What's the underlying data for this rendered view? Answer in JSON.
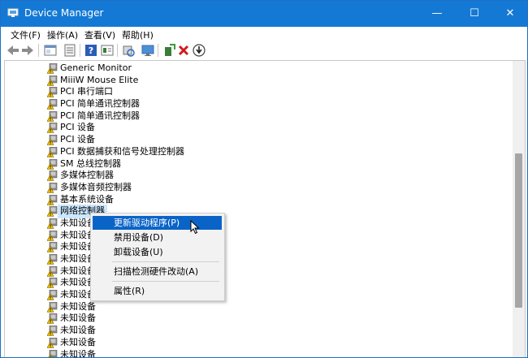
{
  "window": {
    "title": "Device Manager",
    "minimize": "—",
    "maximize": "☐",
    "close": "✕"
  },
  "menu": [
    "文件(F)",
    "操作(A)",
    "查看(V)",
    "帮助(H)"
  ],
  "toolbar_icons": [
    "back-arrow-icon",
    "forward-arrow-icon",
    "properties-sheet-icon",
    "console-tree-icon",
    "help-icon",
    "refresh-panel-icon",
    "scan-hardware-icon",
    "monitor-icon",
    "add-driver-icon",
    "uninstall-x-icon",
    "download-driver-icon"
  ],
  "tree": [
    {
      "label": "Generic Monitor",
      "icon": "monitor-warning"
    },
    {
      "label": "MiiiW Mouse Elite",
      "icon": "device-warning"
    },
    {
      "label": "PCI 串行端口",
      "icon": "device-warning"
    },
    {
      "label": "PCI 简单通讯控制器",
      "icon": "device-warning"
    },
    {
      "label": "PCI 简单通讯控制器",
      "icon": "device-warning"
    },
    {
      "label": "PCI 设备",
      "icon": "device-warning"
    },
    {
      "label": "PCI 设备",
      "icon": "device-warning"
    },
    {
      "label": "PCI 数据捕获和信号处理控制器",
      "icon": "device-warning"
    },
    {
      "label": "SM 总线控制器",
      "icon": "device-warning"
    },
    {
      "label": "多媒体控制器",
      "icon": "device-warning"
    },
    {
      "label": "多媒体音频控制器",
      "icon": "device-warning"
    },
    {
      "label": "基本系统设备",
      "icon": "device-warning"
    },
    {
      "label": "网络控制器",
      "icon": "device-warning",
      "selected": true
    },
    {
      "label": "未知设备",
      "icon": "device-warning"
    },
    {
      "label": "未知设备",
      "icon": "device-warning"
    },
    {
      "label": "未知设备",
      "icon": "device-warning"
    },
    {
      "label": "未知设备",
      "icon": "device-warning"
    },
    {
      "label": "未知设备",
      "icon": "device-warning"
    },
    {
      "label": "未知设备",
      "icon": "device-warning"
    },
    {
      "label": "未知设备",
      "icon": "device-warning"
    },
    {
      "label": "未知设备",
      "icon": "device-warning"
    },
    {
      "label": "未知设备",
      "icon": "device-warning"
    },
    {
      "label": "未知设备",
      "icon": "device-warning"
    },
    {
      "label": "未知设备",
      "icon": "device-warning"
    },
    {
      "label": "未知设备",
      "icon": "device-warning"
    }
  ],
  "context_menu": {
    "update_driver": "更新驱动程序(P)",
    "disable_device": "禁用设备(D)",
    "uninstall_device": "卸载设备(U)",
    "scan_hardware": "扫描检测硬件改动(A)",
    "properties": "属性(R)"
  },
  "colors": {
    "titlebar": "#1479d4",
    "highlight": "#0a64c8",
    "selection": "#cce8ff"
  }
}
